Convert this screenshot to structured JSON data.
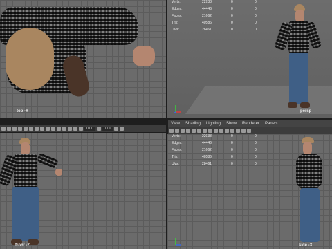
{
  "viewports": {
    "top": {
      "label": "top -Y"
    },
    "persp": {
      "label": "persp",
      "stats": [
        {
          "name": "Verts:",
          "v1": "22938",
          "v2": "0",
          "v3": "0"
        },
        {
          "name": "Edges:",
          "v1": "44446",
          "v2": "0",
          "v3": "0"
        },
        {
          "name": "Faces:",
          "v1": "21662",
          "v2": "0",
          "v3": "0"
        },
        {
          "name": "Tris:",
          "v1": "40586",
          "v2": "0",
          "v3": "0"
        },
        {
          "name": "UVs:",
          "v1": "28461",
          "v2": "0",
          "v3": "0"
        }
      ]
    },
    "front": {
      "label": "front -Z"
    },
    "side": {
      "label": "side -X",
      "stats": [
        {
          "name": "Verts:",
          "v1": "22938",
          "v2": "0",
          "v3": "0"
        },
        {
          "name": "Edges:",
          "v1": "44446",
          "v2": "0",
          "v3": "0"
        },
        {
          "name": "Faces:",
          "v1": "21662",
          "v2": "0",
          "v3": "0"
        },
        {
          "name": "Tris:",
          "v1": "40586",
          "v2": "0",
          "v3": "0"
        },
        {
          "name": "UVs:",
          "v1": "28461",
          "v2": "0",
          "v3": "0"
        }
      ]
    }
  },
  "panel_menu": [
    "View",
    "Shading",
    "Lighting",
    "Show",
    "Renderer",
    "Panels"
  ],
  "toolbar": {
    "field1": "0.00",
    "field2": "1.00"
  }
}
